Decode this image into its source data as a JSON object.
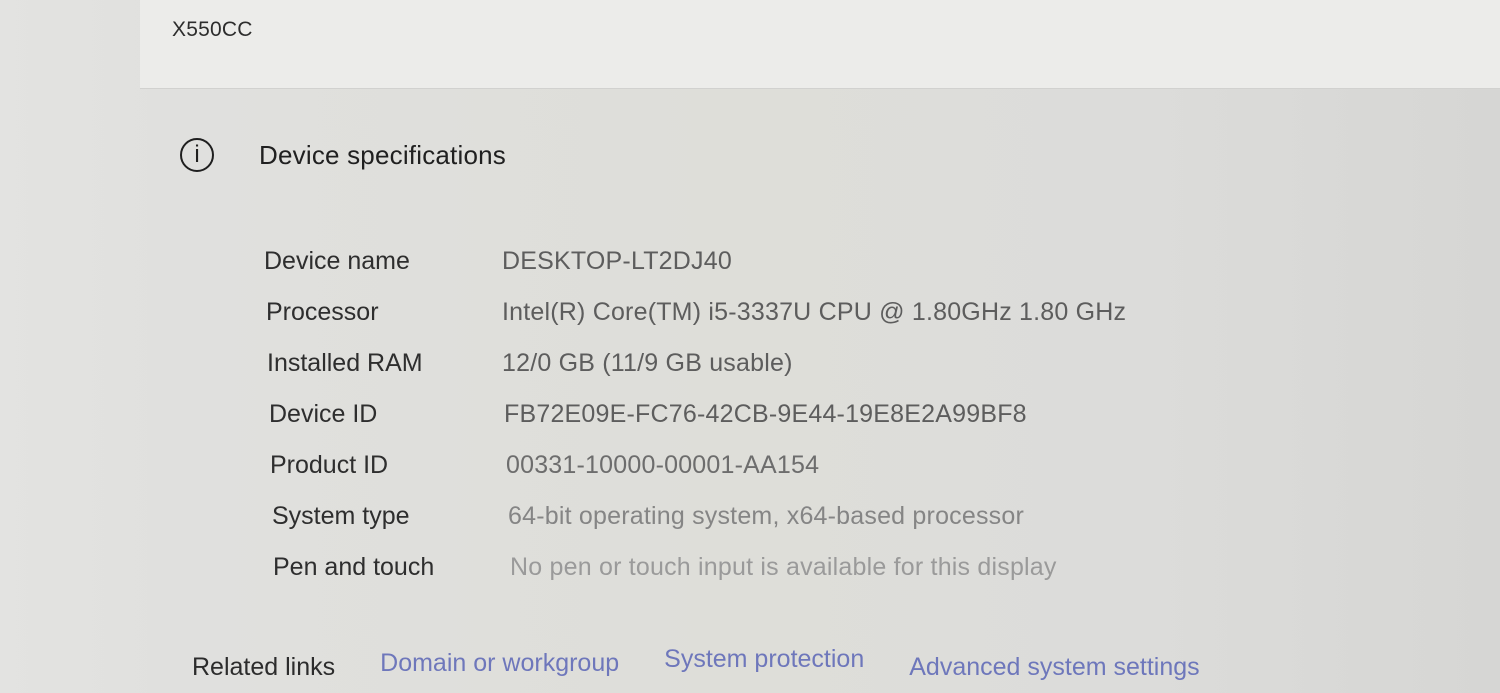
{
  "top": {
    "model": "X550CC"
  },
  "device_specifications": {
    "title": "Device specifications",
    "icon": "info-icon",
    "rows": [
      {
        "label": "Device name",
        "value": "DESKTOP-LT2DJ40"
      },
      {
        "label": "Processor",
        "value": "Intel(R) Core(TM) i5-3337U CPU @ 1.80GHz   1.80 GHz"
      },
      {
        "label": "Installed RAM",
        "value": "12/0 GB (11/9 GB usable)"
      },
      {
        "label": "Device ID",
        "value": "FB72E09E-FC76-42CB-9E44-19E8E2A99BF8"
      },
      {
        "label": "Product ID",
        "value": "00331-10000-00001-AA154"
      },
      {
        "label": "System type",
        "value": "64-bit operating system, x64-based processor"
      },
      {
        "label": "Pen and touch",
        "value": "No pen or touch input is available for this display"
      }
    ]
  },
  "related_links": {
    "label": "Related links",
    "links": [
      {
        "label": "Domain or workgroup"
      },
      {
        "label": "System protection"
      },
      {
        "label": "Advanced system settings"
      }
    ]
  },
  "colors": {
    "background": "#deded9",
    "text": "#2e2e2e",
    "value_text": "#5d5d5d",
    "link": "#4f5bb3"
  }
}
